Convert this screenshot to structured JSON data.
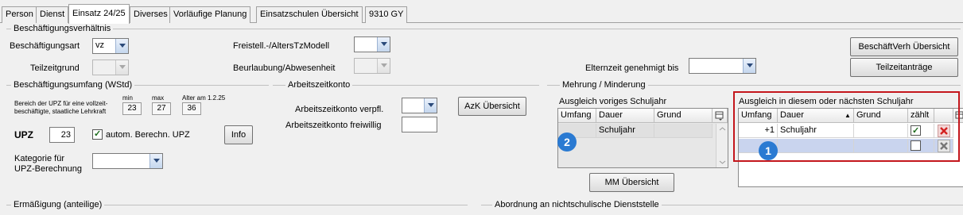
{
  "tabs": [
    "Person",
    "Dienst",
    "Einsatz 24/25",
    "Diverses",
    "Vorläufige Planung",
    "Einsatzschulen Übersicht",
    "9310 GY"
  ],
  "sections": {
    "beschaeftigungsverhaeltnis": "Beschäftigungsverhältnis",
    "beschaeftigungsumfang": "Beschäftigungsumfang (WStd)",
    "arbeitszeitkonto": "Arbeitszeitkonto",
    "mehrung": "Mehrung / Minderung",
    "ermaessigung": "Ermäßigung (anteilige)",
    "abordnung": "Abordnung an nichtschulische Dienststelle"
  },
  "verhaeltnis": {
    "beschaeftigungsart_label": "Beschäftigungsart",
    "beschaeftigungsart_value": "vz",
    "teilzeitgrund_label": "Teilzeitgrund",
    "freistell_label": "Freistell.-/AltersTzModell",
    "beurlaubung_label": "Beurlaubung/Abwesenheit",
    "elternzeit_label": "Elternzeit genehmigt bis",
    "btn_beschaeft": "BeschäftVerh Übersicht",
    "btn_teilzeit": "Teilzeitanträge"
  },
  "umfang": {
    "bereich_text": "Bereich der UPZ für eine vollzeit-beschäftigte, staatliche Lehrkraft",
    "min_label": "min",
    "max_label": "max",
    "alter_label": "Alter am 1.2.25",
    "min_value": "23",
    "max_value": "27",
    "alter_value": "36",
    "upz_label": "UPZ",
    "upz_value": "23",
    "autom_label": "autom. Berechn. UPZ",
    "info_btn": "Info",
    "kategorie_label_1": "Kategorie für",
    "kategorie_label_2": "UPZ-Berechnung"
  },
  "azk": {
    "verpfl_label": "Arbeitszeitkonto verpfl.",
    "freiwillig_label": "Arbeitszeitkonto freiwillig",
    "btn": "AzK Übersicht"
  },
  "voriges": {
    "title": "Ausgleich voriges Schuljahr",
    "columns": [
      "Umfang",
      "Dauer",
      "Grund"
    ],
    "rows": [
      [
        "",
        "Schuljahr",
        ""
      ]
    ],
    "badge": "2"
  },
  "diesem": {
    "title": "Ausgleich in diesem oder nächsten Schuljahr",
    "columns": [
      "Umfang",
      "Dauer",
      "Grund",
      "zählt"
    ],
    "rows": [
      {
        "umfang": "+1",
        "dauer": "Schuljahr",
        "grund": "",
        "zaehlt": true
      },
      {
        "umfang": "",
        "dauer": "",
        "grund": "",
        "zaehlt": false
      }
    ],
    "badge": "1",
    "highlight_color": "#c4161c"
  },
  "mm_btn": "MM Übersicht"
}
